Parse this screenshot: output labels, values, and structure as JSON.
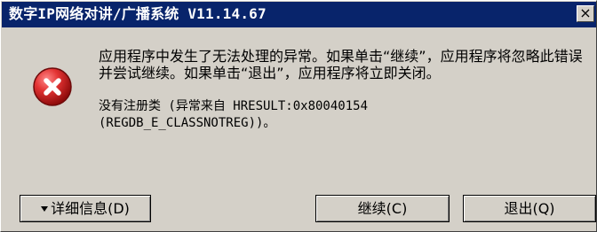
{
  "window": {
    "title": "数字IP网络对讲/广播系统 V11.14.67"
  },
  "titlebar": {
    "close_label": "×"
  },
  "dialog": {
    "icon": "error-icon",
    "message": "应用程序中发生了无法处理的异常。如果单击“继续”，应用程序将忽略此错误并尝试继续。如果单击“退出”，应用程序将立即关闭。",
    "detail": "没有注册类 (异常来自 HRESULT:0x80040154\n(REGDB_E_CLASSNOTREG))。"
  },
  "buttons": {
    "details_label": "详细信息(D)",
    "continue_label": "继续(C)",
    "quit_label": "退出(Q)"
  },
  "colors": {
    "titlebar": "#08246b",
    "face": "#d4d0c8",
    "error_red": "#d21f1f"
  }
}
